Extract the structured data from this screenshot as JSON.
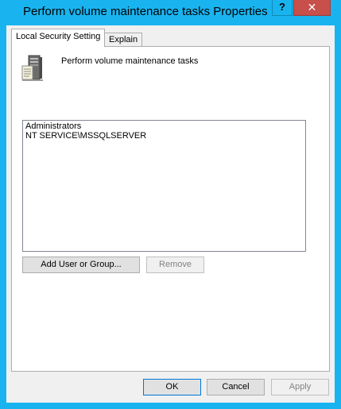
{
  "window": {
    "title": "Perform volume maintenance tasks Properties",
    "help_label": "?",
    "close_label": "✕"
  },
  "tabs": [
    {
      "label": "Local Security Setting",
      "active": true
    },
    {
      "label": "Explain",
      "active": false
    }
  ],
  "policy": {
    "icon": "server-policy-icon",
    "name": "Perform volume maintenance tasks"
  },
  "accounts": [
    "Administrators",
    "NT SERVICE\\MSSQLSERVER"
  ],
  "buttons": {
    "add": "Add User or Group...",
    "remove": "Remove",
    "ok": "OK",
    "cancel": "Cancel",
    "apply": "Apply"
  },
  "colors": {
    "title_bar": "#19b4f0",
    "close_button": "#c7504b"
  }
}
